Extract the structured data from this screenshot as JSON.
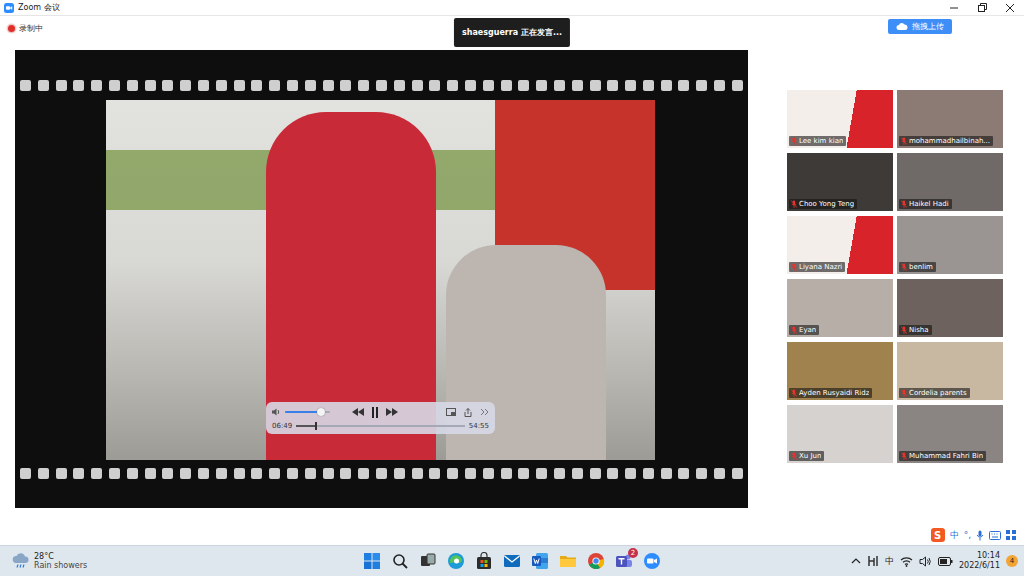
{
  "window": {
    "title": "Zoom 会议"
  },
  "recording": {
    "label": "录制中",
    "on": true
  },
  "speaker_banner": {
    "text": "shaesguerra 正在发言..."
  },
  "upload_button": {
    "label": "拖拽上传"
  },
  "video_player": {
    "playing": true,
    "volume": {
      "level": 0.8
    },
    "progress": {
      "level": 0.12
    },
    "current_time": "06:49",
    "total_time": "54:55"
  },
  "participants": [
    {
      "name": "Lee kim kian",
      "muted": true
    },
    {
      "name": "mohammadhailbinah...",
      "muted": true
    },
    {
      "name": "Choo Yong Teng",
      "muted": true
    },
    {
      "name": "Haikel Hadi",
      "muted": true
    },
    {
      "name": "Liyana Nazri",
      "muted": true
    },
    {
      "name": "benlim",
      "muted": true
    },
    {
      "name": "Eyan",
      "muted": true
    },
    {
      "name": "Nisha",
      "muted": true
    },
    {
      "name": "Ayden Rusyaidi Ridz",
      "muted": true
    },
    {
      "name": "Cordelia parents",
      "muted": true
    },
    {
      "name": "Xu Jun",
      "muted": true
    },
    {
      "name": "Muhammad Fahri Bin",
      "muted": true
    }
  ],
  "ime_toolbar": {
    "logo": "S",
    "mode": "中",
    "punctuation": "°,"
  },
  "taskbar": {
    "weather": {
      "temperature": "28°C",
      "condition": "Rain showers"
    },
    "teams_badge": "2",
    "tray": {
      "input_mode": "中",
      "time": "10:14",
      "date": "2022/6/11",
      "notification_count": "4"
    }
  }
}
